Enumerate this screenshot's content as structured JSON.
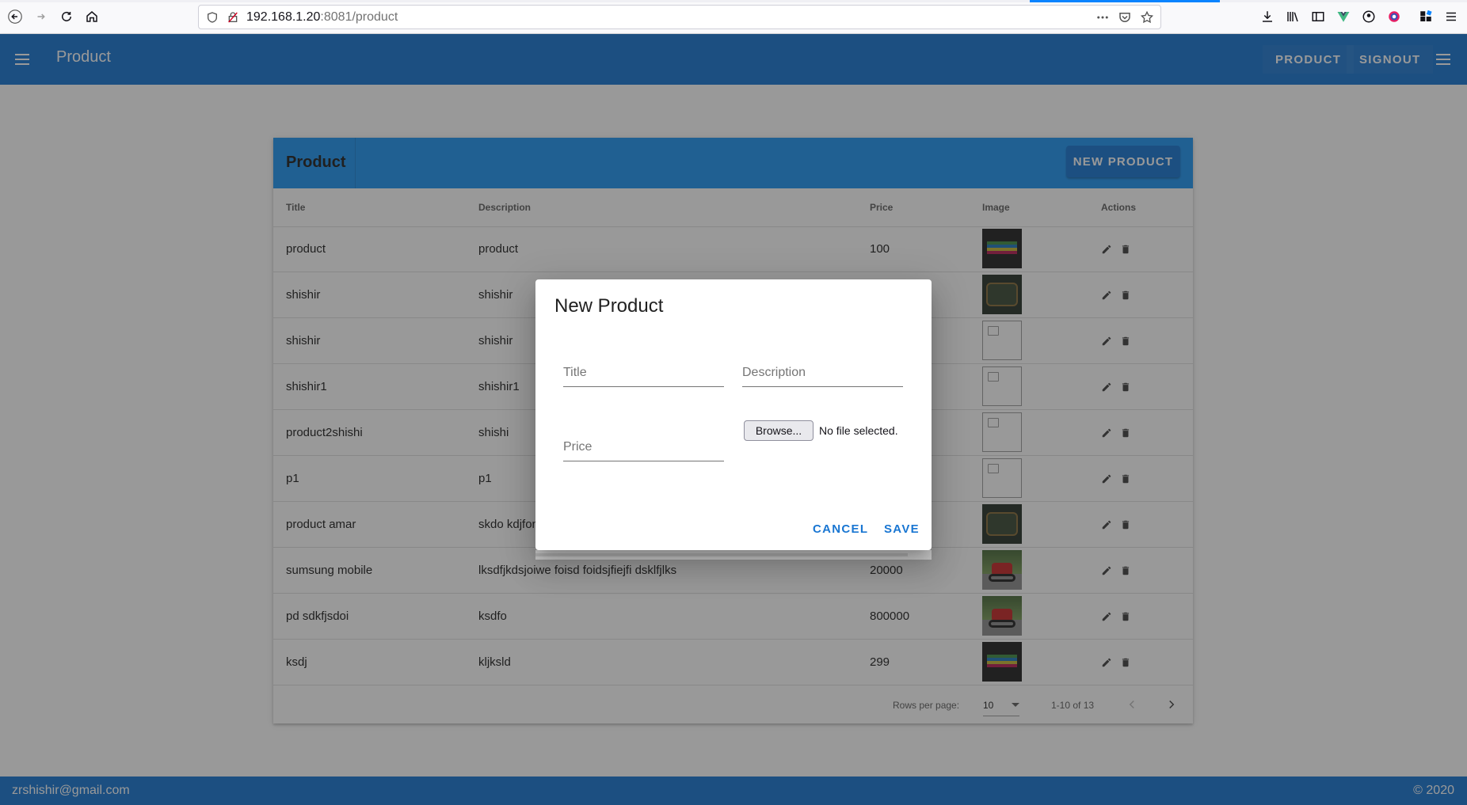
{
  "browser": {
    "url_host": "192.168.1.20",
    "url_path": ":8081/product"
  },
  "app_bar": {
    "title": "Product",
    "product_label": "PRODUCT",
    "signout_label": "SIGNOUT"
  },
  "card": {
    "title": "Product",
    "new_button_label": "NEW PRODUCT",
    "columns": [
      "Title",
      "Description",
      "Price",
      "Image",
      "Actions"
    ],
    "rows": [
      {
        "title": "product",
        "description": "product",
        "price": "100",
        "image": "rainbow-thumbnail"
      },
      {
        "title": "shishir",
        "description": "shishir",
        "price": "",
        "image": "badge-thumbnail"
      },
      {
        "title": "shishir",
        "description": "shishir",
        "price": "",
        "image": "broken-image"
      },
      {
        "title": "shishir1",
        "description": "shishir1",
        "price": "",
        "image": "broken-image"
      },
      {
        "title": "product2shishi",
        "description": "shishi",
        "price": "",
        "image": "broken-image"
      },
      {
        "title": "p1",
        "description": "p1",
        "price": "",
        "image": "broken-image"
      },
      {
        "title": "product amar",
        "description": "skdo kdjfon",
        "price": "",
        "image": "badge-thumbnail"
      },
      {
        "title": "sumsung mobile",
        "description": "lksdfjkdsjoiwe foisd foidsjfiejfi dsklfjlks",
        "price": "20000",
        "image": "motorcycle-thumbnail"
      },
      {
        "title": "pd sdkfjsdoi",
        "description": "ksdfo",
        "price": "800000",
        "image": "motorcycle-thumbnail"
      },
      {
        "title": "ksdj",
        "description": "kljksld",
        "price": "299",
        "image": "rainbow-thumbnail"
      }
    ],
    "footer": {
      "rows_per_page_label": "Rows per page:",
      "rows_per_page_value": "10",
      "page_info": "1-10 of 13"
    }
  },
  "dialog": {
    "title": "New Product",
    "title_placeholder": "Title",
    "description_placeholder": "Description",
    "price_placeholder": "Price",
    "browse_label": "Browse...",
    "file_status": "No file selected.",
    "cancel_label": "CANCEL",
    "save_label": "SAVE"
  },
  "bottom_bar": {
    "email": "zrshishir@gmail.com",
    "copyright": "© 2020"
  },
  "colors": {
    "primary": "#1976d2",
    "toolbar_blue": "#2196f3"
  }
}
